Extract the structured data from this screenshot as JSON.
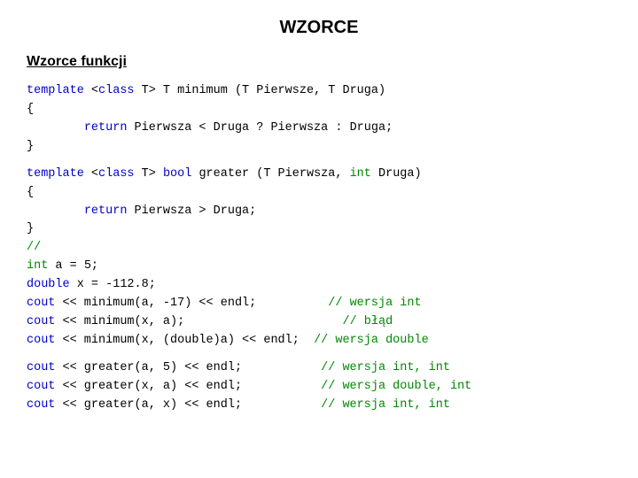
{
  "title": "WZORCE",
  "section": "Wzorce funkcji",
  "code": {
    "lines": []
  }
}
